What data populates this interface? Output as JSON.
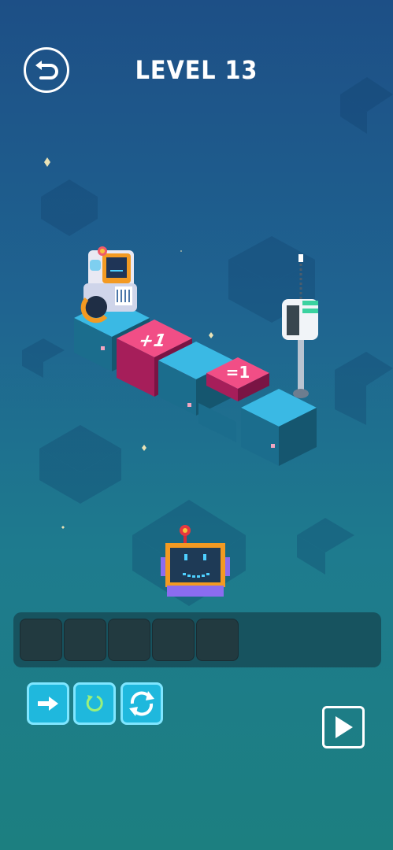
{
  "header": {
    "level_title": "LEVEL 13",
    "back_icon": "undo-arrow-icon"
  },
  "board": {
    "tiles": [
      {
        "kind": "floor"
      },
      {
        "kind": "pressure-pad",
        "label": "+1"
      },
      {
        "kind": "floor"
      },
      {
        "kind": "pressure-pad",
        "label": "=1"
      },
      {
        "kind": "floor"
      }
    ],
    "robot_icon": "robot-with-flower-icon",
    "goal_icon": "antenna-beacon-icon"
  },
  "function_block": {
    "icon": "robot-face-function-icon"
  },
  "program": {
    "slot_count": 5
  },
  "commands": [
    {
      "name": "move-forward",
      "icon": "right-arrow-icon"
    },
    {
      "name": "turn",
      "icon": "rotate-icon"
    },
    {
      "name": "loop",
      "icon": "repeat-cycle-icon"
    }
  ],
  "controls": {
    "play_icon": "play-icon"
  },
  "colors": {
    "bg_top": "#1d4f86",
    "bg_bottom": "#1c7f80",
    "tile_top": "#35b6e6",
    "pad_top": "#ef4f86",
    "command_fill": "#1fb8dd"
  }
}
